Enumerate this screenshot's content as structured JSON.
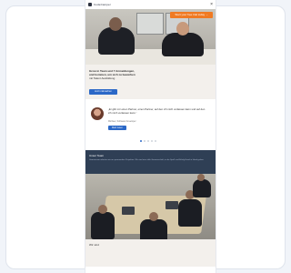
{
  "header": {
    "brand_name": "CodeCamper",
    "close_glyph": "×",
    "cta_label": "Start your free trial today →"
  },
  "intro": {
    "line1": "Grow in Team und 7 Anmeldungen,",
    "line2": "und kommen, um sich zu bewerben",
    "line3": "mit Talent Ausbildung",
    "button_label": "Jetzt mitmachen"
  },
  "testimonial": {
    "quote": "„Er gibt mir einen Partner, einen Partner, auf den ich mich verlassen kann und auf den ich mich verlassen kann.“",
    "meta": "Michael, Software Developer",
    "button_label": "Mehr lesen",
    "dots": [
      true,
      false,
      false,
      false,
      false
    ]
  },
  "dark_card": {
    "title": "Unser Team",
    "text": "Gemeinsam arbeiten wir an spannenden Projekten. Wir sind eine tolle Gemeinschaft, in der Spaß und Erfolg Hand in Hand gehen."
  },
  "footer": {
    "title": "Wir sind"
  },
  "colors": {
    "accent_orange": "#f07a22",
    "accent_blue": "#2b68c7",
    "dark_card": "#2f3f55"
  }
}
